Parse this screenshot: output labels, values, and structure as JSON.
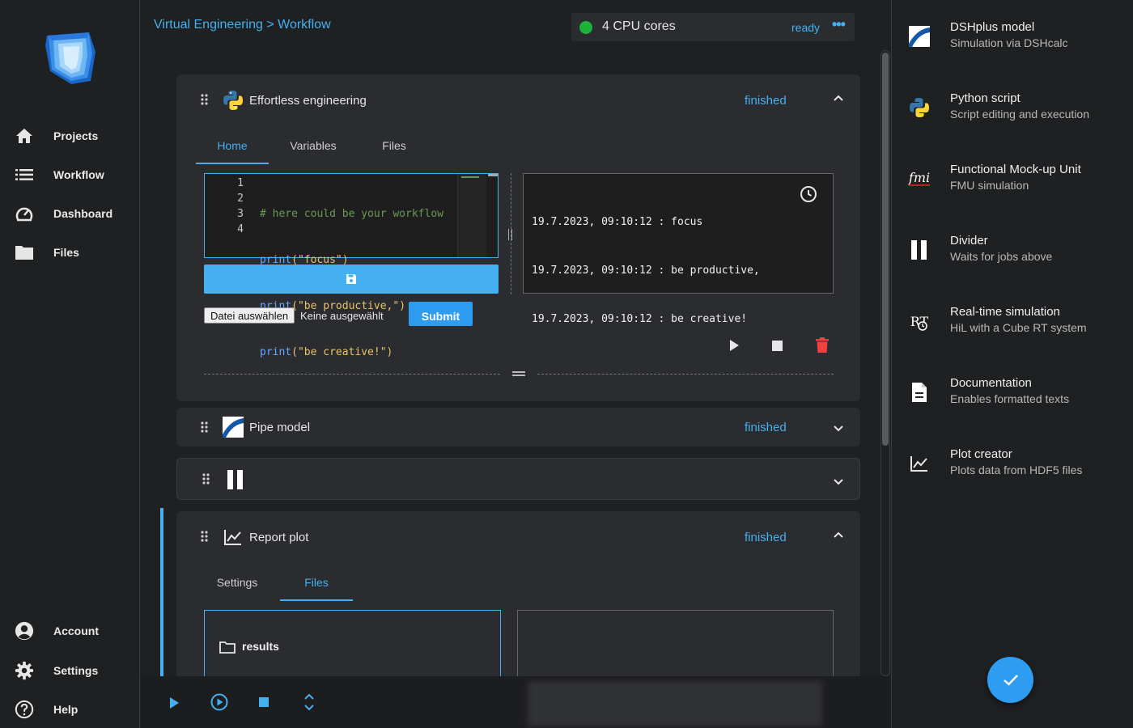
{
  "sidebar": {
    "items": [
      {
        "label": "Projects"
      },
      {
        "label": "Workflow"
      },
      {
        "label": "Dashboard"
      },
      {
        "label": "Files"
      }
    ],
    "bottom": [
      {
        "label": "Account"
      },
      {
        "label": "Settings"
      },
      {
        "label": "Help"
      }
    ]
  },
  "header": {
    "breadcrumb": "Virtual Engineering > Workflow",
    "cpu_label": "4 CPU cores",
    "cpu_status": "ready"
  },
  "cards": {
    "python": {
      "title": "Effortless engineering",
      "status": "finished",
      "tabs": [
        "Home",
        "Variables",
        "Files"
      ],
      "code_lines": [
        "1",
        "2",
        "3",
        "4"
      ],
      "code": [
        "# here could be your workflow",
        "print(\"focus\")",
        "print(\"be productive,\")",
        "print(\"be creative!\")"
      ],
      "code_parts": [
        {
          "c": "# here could be your workflow"
        },
        {
          "k": "print",
          "s": "(\"focus\")"
        },
        {
          "k": "print",
          "s": "(\"be productive,\")"
        },
        {
          "k": "print",
          "s": "(\"be creative!\")"
        }
      ],
      "output": [
        "19.7.2023, 09:10:12 : focus",
        "19.7.2023, 09:10:12 : be productive,",
        "19.7.2023, 09:10:12 : be creative!"
      ],
      "file_button": "Datei auswählen",
      "file_none": "Keine ausgewählt",
      "submit": "Submit"
    },
    "pipe": {
      "title": "Pipe model",
      "status": "finished"
    },
    "report": {
      "title": "Report plot",
      "status": "finished",
      "tabs": [
        "Settings",
        "Files"
      ],
      "folder": "results"
    }
  },
  "library": [
    {
      "title": "DSHplus model",
      "subtitle": "Simulation via DSHcalc",
      "icon": "dshplus-icon"
    },
    {
      "title": "Python script",
      "subtitle": "Script editing and execution",
      "icon": "python-icon"
    },
    {
      "title": "Functional Mock-up Unit",
      "subtitle": "FMU simulation",
      "icon": "fmi-icon"
    },
    {
      "title": "Divider",
      "subtitle": "Waits for jobs above",
      "icon": "pause-icon"
    },
    {
      "title": "Real-time simulation",
      "subtitle": "HiL with a Cube RT system",
      "icon": "rt-icon"
    },
    {
      "title": "Documentation",
      "subtitle": "Enables formatted texts",
      "icon": "document-icon"
    },
    {
      "title": "Plot creator",
      "subtitle": "Plots data from HDF5 files",
      "icon": "plot-icon"
    }
  ],
  "icons": {
    "fmi_glyph": "fmi",
    "rt_glyph": "RT"
  },
  "colors": {
    "accent": "#45b0f0",
    "status_green": "#1db33a",
    "delete_red": "#f04040",
    "fab": "#2e9cf0"
  }
}
